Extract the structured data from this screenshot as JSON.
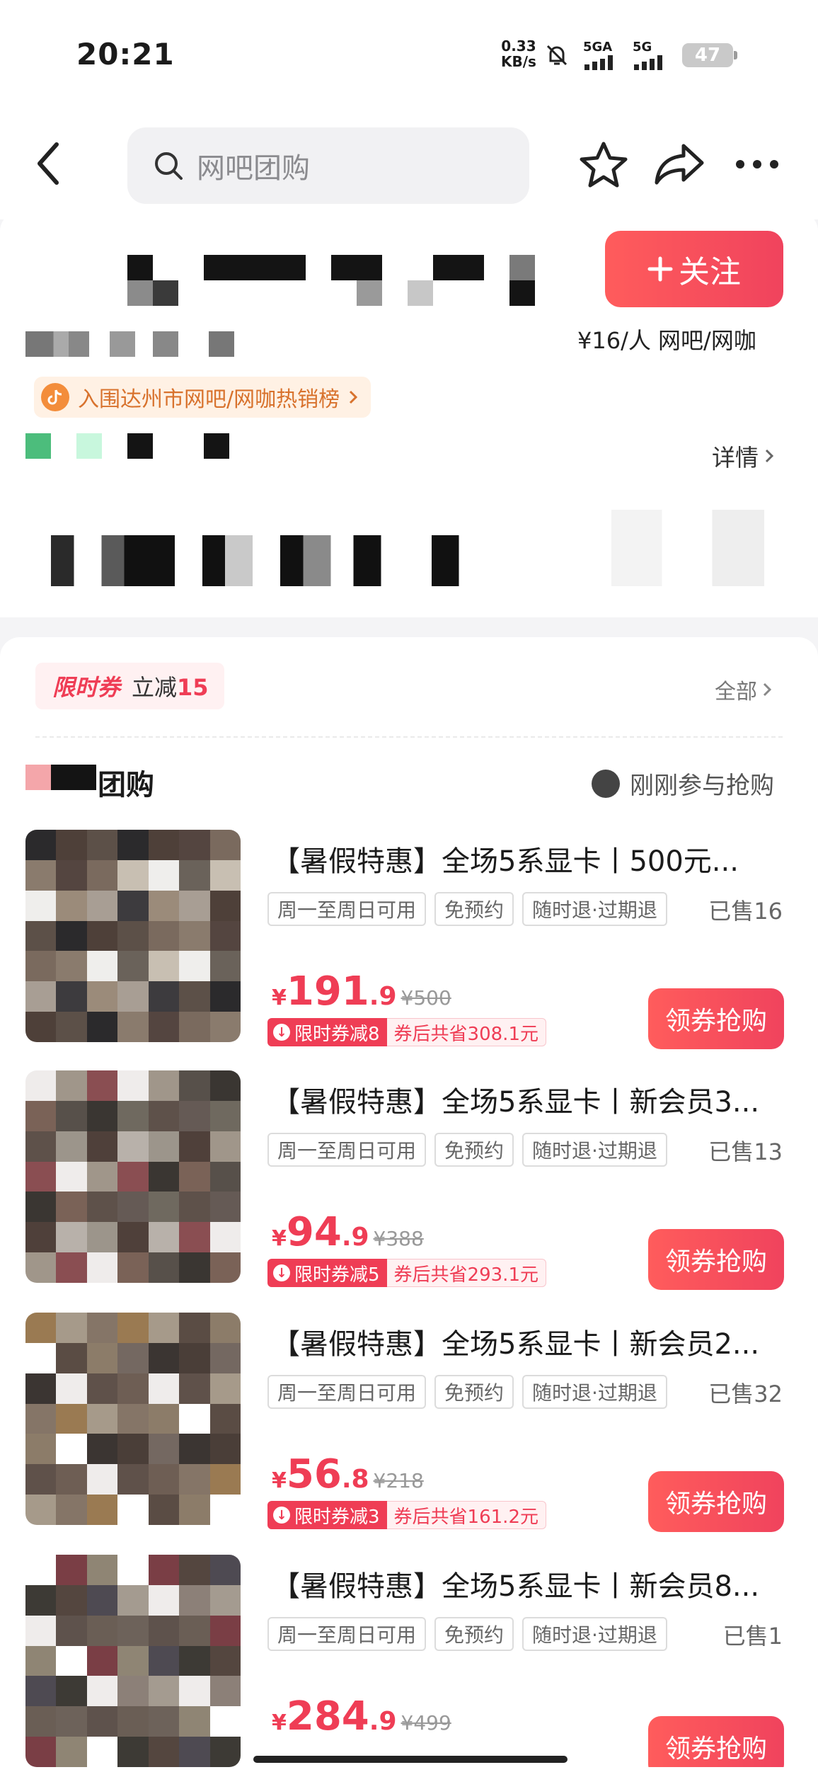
{
  "status_bar": {
    "time": "20:21",
    "net_speed": "0.33\nKB/s",
    "net_speed_value": "0.33",
    "net_speed_unit": "KB/s",
    "signal_1": "5GA",
    "signal_2": "5G",
    "battery": "47"
  },
  "nav": {
    "search_placeholder": "网吧团购",
    "icons": [
      "back-icon",
      "search-icon",
      "star-icon",
      "share-icon",
      "more-icon"
    ]
  },
  "shop": {
    "follow_label": "关注",
    "price_category": "¥16/人  网吧/网咖",
    "rank_text": "入围达州市网吧/网咖热销榜",
    "detail_label": "详情"
  },
  "coupon": {
    "tag": "限时券",
    "desc_prefix": "立减",
    "desc_amount": "15",
    "all_label": "全部"
  },
  "group": {
    "title_suffix": "团购",
    "recent_label": "刚刚参与抢购"
  },
  "deals": [
    {
      "title": "【暑假特惠】全场5系显卡丨500元...",
      "tags": [
        "周一至周日可用",
        "免预约",
        "随时退·过期退"
      ],
      "sold": "已售16",
      "price_currency": "¥",
      "price_int": "191",
      "price_dec": ".9",
      "original_price": "¥500",
      "coupon_label": "限时券减8",
      "savings": "券后共省308.1元",
      "buy_label": "领券抢购"
    },
    {
      "title": "【暑假特惠】全场5系显卡丨新会员3...",
      "tags": [
        "周一至周日可用",
        "免预约",
        "随时退·过期退"
      ],
      "sold": "已售13",
      "price_currency": "¥",
      "price_int": "94",
      "price_dec": ".9",
      "original_price": "¥388",
      "coupon_label": "限时券减5",
      "savings": "券后共省293.1元",
      "buy_label": "领券抢购"
    },
    {
      "title": "【暑假特惠】全场5系显卡丨新会员2...",
      "tags": [
        "周一至周日可用",
        "免预约",
        "随时退·过期退"
      ],
      "sold": "已售32",
      "price_currency": "¥",
      "price_int": "56",
      "price_dec": ".8",
      "original_price": "¥218",
      "coupon_label": "限时券减3",
      "savings": "券后共省161.2元",
      "buy_label": "领券抢购"
    },
    {
      "title": "【暑假特惠】全场5系显卡丨新会员8...",
      "tags": [
        "周一至周日可用",
        "免预约",
        "随时退·过期退"
      ],
      "sold": "已售1",
      "price_currency": "¥",
      "price_int": "284",
      "price_dec": ".9",
      "original_price": "¥499",
      "coupon_label": "",
      "savings": "",
      "buy_label": "领券抢购"
    }
  ],
  "colors": {
    "accent": "#ef3d55",
    "rank": "#d8722d"
  }
}
